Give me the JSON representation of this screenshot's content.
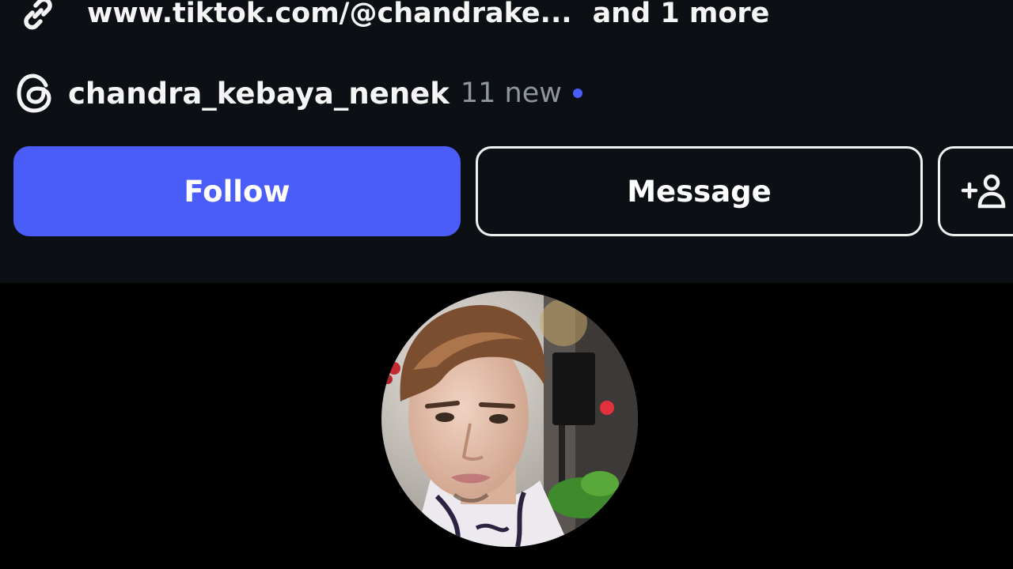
{
  "profile": {
    "link": {
      "icon": "link-icon",
      "text": "www.tiktok.com/@chandrake...",
      "more": "and 1 more"
    },
    "threads": {
      "icon": "threads-icon",
      "handle": "chandra_kebaya_nenek",
      "new_count": "11 new",
      "dot_icon": "new-indicator-dot"
    },
    "actions": {
      "follow_label": "Follow",
      "message_label": "Message",
      "add_user_icon": "add-user-icon"
    },
    "avatar": {
      "icon": "profile-photo"
    }
  },
  "colors": {
    "panel_bg": "#0c1014",
    "page_bg": "#000000",
    "accent": "#4a5df9",
    "text": "#f5f5f5",
    "muted": "#8e959e"
  }
}
